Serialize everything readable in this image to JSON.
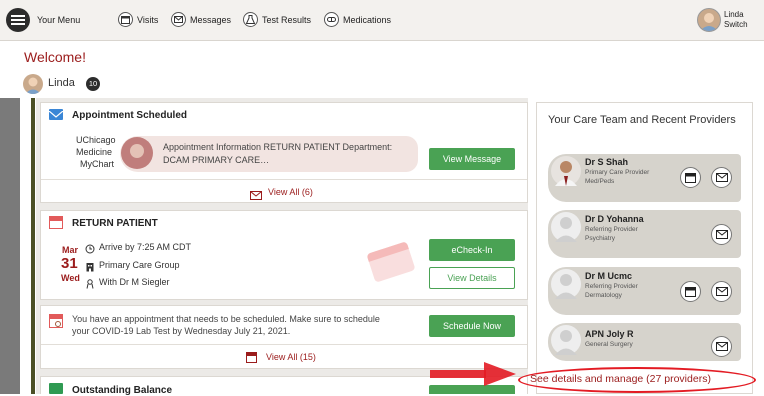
{
  "nav": {
    "menu_label": "Your Menu",
    "items": [
      {
        "label": "Visits",
        "icon": "calendar-icon"
      },
      {
        "label": "Messages",
        "icon": "envelope-icon"
      },
      {
        "label": "Test Results",
        "icon": "flask-icon"
      },
      {
        "label": "Medications",
        "icon": "pill-icon"
      }
    ],
    "user_name": "Linda",
    "switch_label": "Switch"
  },
  "welcome": {
    "title": "Welcome!",
    "user_name": "Linda",
    "count": "10"
  },
  "appointment_card": {
    "title": "Appointment Scheduled",
    "sender_line1": "UChicago",
    "sender_line2": "Medicine",
    "sender_line3": "MyChart",
    "message_line1": "Appointment Information RETURN PATIENT Department:",
    "message_line2": "DCAM PRIMARY CARE…",
    "button": "View Message",
    "view_all": "View All (6)"
  },
  "return_card": {
    "title": "RETURN PATIENT",
    "month": "Mar",
    "day": "31",
    "weekday": "Wed",
    "arrive": "Arrive by 7:25 AM CDT",
    "location": "Primary Care Group",
    "provider": "With Dr M Siegler",
    "checkin_button": "eCheck-In",
    "details_button": "View Details"
  },
  "schedule_card": {
    "line1": "You have an appointment that needs to be scheduled. Make sure to schedule",
    "line2": "your COVID-19 Lab Test by Wednesday July 21, 2021.",
    "button": "Schedule Now",
    "view_all": "View All (15)"
  },
  "balance_card": {
    "title": "Outstanding Balance"
  },
  "care_team": {
    "title": "Your Care Team and Recent Providers",
    "providers": [
      {
        "name": "Dr S Shah",
        "role": "Primary Care Provider",
        "dept": "Med/Peds"
      },
      {
        "name": "Dr D Yohanna",
        "role": "Referring Provider",
        "dept": "Psychiatry"
      },
      {
        "name": "Dr M Ucmc",
        "role": "Referring Provider",
        "dept": "Dermatology"
      },
      {
        "name": "APN Joly R",
        "role": "",
        "dept": "General Surgery"
      }
    ],
    "see_details": "See details and manage (27 providers)"
  },
  "colors": {
    "brand_red": "#9b1c1c",
    "action_green": "#4aa254",
    "annotation_red": "#e31b23"
  }
}
